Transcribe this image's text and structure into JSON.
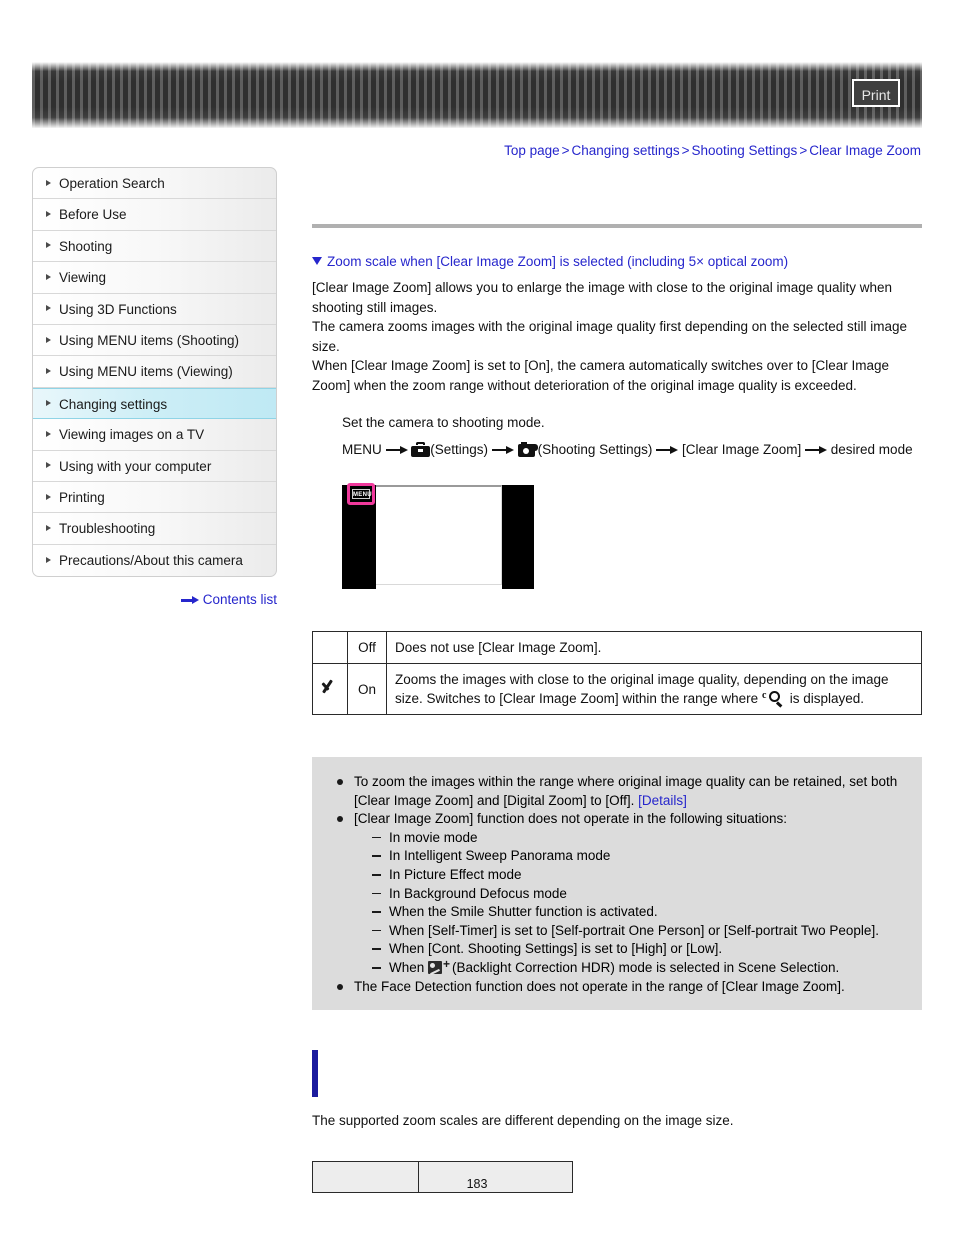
{
  "header": {
    "print_label": "Print"
  },
  "breadcrumb": {
    "items": [
      "Top page",
      "Changing settings",
      "Shooting Settings",
      "Clear Image Zoom"
    ],
    "separator": ">"
  },
  "sidebar": {
    "items": [
      {
        "label": "Operation Search",
        "active": false
      },
      {
        "label": "Before Use",
        "active": false
      },
      {
        "label": "Shooting",
        "active": false
      },
      {
        "label": "Viewing",
        "active": false
      },
      {
        "label": "Using 3D Functions",
        "active": false
      },
      {
        "label": "Using MENU items (Shooting)",
        "active": false
      },
      {
        "label": "Using MENU items (Viewing)",
        "active": false
      },
      {
        "label": "Changing settings",
        "active": true
      },
      {
        "label": "Viewing images on a TV",
        "active": false
      },
      {
        "label": "Using with your computer",
        "active": false
      },
      {
        "label": "Printing",
        "active": false
      },
      {
        "label": "Troubleshooting",
        "active": false
      },
      {
        "label": "Precautions/About this camera",
        "active": false
      }
    ],
    "contents_list_label": "Contents list"
  },
  "main": {
    "section_heading": "Zoom scale when [Clear Image Zoom] is selected (including 5× optical zoom)",
    "paragraph_1": "[Clear Image Zoom] allows you to enlarge the image with close to the original image quality when shooting still images.",
    "paragraph_2": "The camera zooms images with the original image quality first depending on the selected still image size.",
    "paragraph_3": "When [Clear Image Zoom] is set to [On], the camera automatically switches over to [Clear Image Zoom] when the zoom range without deterioration of the original image quality is exceeded.",
    "step_1": "Set the camera to shooting mode.",
    "menu_path": {
      "menu": "MENU",
      "settings_label": "(Settings)",
      "shooting_settings_label": "(Shooting Settings)",
      "item_label": "[Clear Image Zoom]",
      "tail_label": "desired mode"
    },
    "lcd": {
      "menu_button_label": "MENU"
    },
    "options_table": {
      "rows": [
        {
          "checked": false,
          "option": "Off",
          "description": "Does not use [Clear Image Zoom]."
        },
        {
          "checked": true,
          "option": "On",
          "description_part1": "Zooms the images with close to the original image quality, depending on the image size. Switches to [Clear Image Zoom] within the range where",
          "description_part2": "is displayed."
        }
      ]
    },
    "notes": {
      "note_1_part1": "To zoom the images within the range where original image quality can be retained, set both [Clear Image Zoom] and [Digital Zoom] to [Off].",
      "note_1_link": "[Details]",
      "note_2": "[Clear Image Zoom] function does not operate in the following situations:",
      "sub_notes": [
        "In movie mode",
        "In Intelligent Sweep Panorama mode",
        "In Picture Effect mode",
        "In Background Defocus mode",
        "When the Smile Shutter function is activated.",
        "When [Self-Timer] is set to [Self-portrait One Person] or [Self-portrait Two People].",
        "When [Cont. Shooting Settings] is set to [High] or [Low]."
      ],
      "sub_note_hdr_prefix": "When",
      "sub_note_hdr_suffix": "(Backlight Correction HDR) mode is selected in Scene Selection.",
      "note_3": "The Face Detection function does not operate in the range of [Clear Image Zoom]."
    },
    "bottom_note": "The supported zoom scales are different depending on the image size."
  },
  "footer": {
    "page_number": "183"
  },
  "colors": {
    "link": "#2626cc",
    "highlight": "#bfe9f4",
    "notes_bg": "#dcdcdc",
    "blue_bar": "#1b1b9e",
    "menu_highlight": "#f0399c"
  }
}
